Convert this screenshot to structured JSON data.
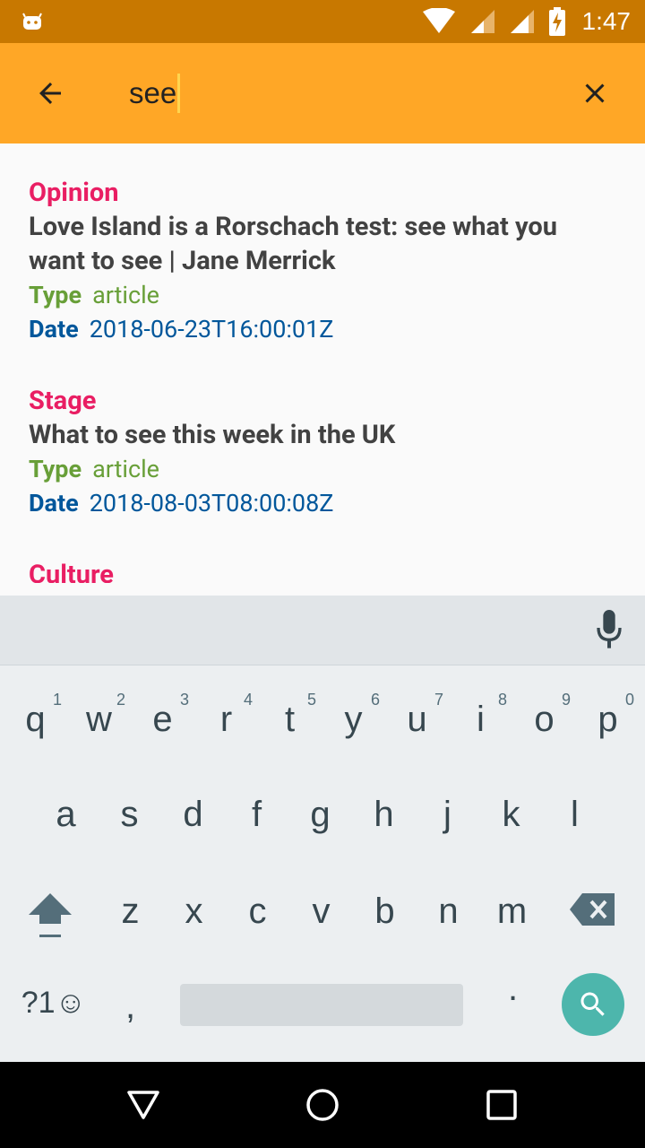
{
  "status_bar": {
    "time": "1:47",
    "background_color": "#c87800",
    "icons": [
      "android-notification-icon",
      "wifi-icon",
      "signal-icon",
      "signal-icon",
      "battery-charging-icon"
    ]
  },
  "toolbar": {
    "query": "see",
    "background_color": "#ffa726",
    "back_icon": "arrow-back-icon",
    "clear_icon": "close-icon"
  },
  "results": [
    {
      "section": "Opinion",
      "headline": "Love Island is a Rorschach test: see what you want to see | Jane Merrick",
      "type_label": "Type",
      "type_value": "article",
      "date_label": "Date",
      "date_value": "2018-06-23T16:00:01Z"
    },
    {
      "section": "Stage",
      "headline": "What to see this week in the UK",
      "type_label": "Type",
      "type_value": "article",
      "date_label": "Date",
      "date_value": "2018-08-03T08:00:08Z"
    },
    {
      "section": "Culture"
    }
  ],
  "colors": {
    "section": "#e91e63",
    "headline": "#424242",
    "type": "#689f38",
    "date": "#01579b"
  },
  "keyboard": {
    "row1": [
      "q",
      "w",
      "e",
      "r",
      "t",
      "y",
      "u",
      "i",
      "o",
      "p"
    ],
    "row1_hints": [
      "1",
      "2",
      "3",
      "4",
      "5",
      "6",
      "7",
      "8",
      "9",
      "0"
    ],
    "row2": [
      "a",
      "s",
      "d",
      "f",
      "g",
      "h",
      "j",
      "k",
      "l"
    ],
    "row3": [
      "z",
      "x",
      "c",
      "v",
      "b",
      "n",
      "m"
    ],
    "symbols_key": "?1☺",
    "comma_key": ",",
    "period_key": ".",
    "action_icon": "search-icon",
    "mic_icon": "mic-icon",
    "shift_icon": "shift-icon",
    "backspace_icon": "backspace-icon"
  },
  "nav_bar": {
    "icons": [
      "back-triangle-icon",
      "home-circle-icon",
      "recents-square-icon"
    ]
  }
}
